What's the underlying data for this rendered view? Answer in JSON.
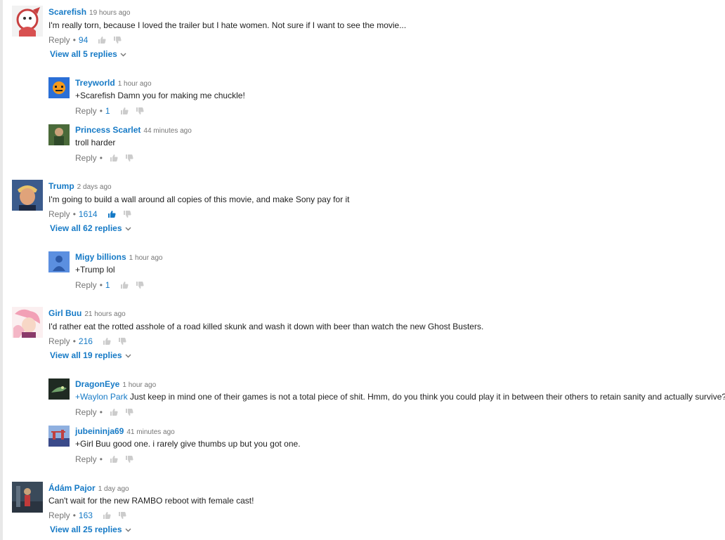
{
  "labels": {
    "reply": "Reply",
    "dot": "•"
  },
  "comments": [
    {
      "author": "Scarefish",
      "time": "19 hours ago",
      "text": "I'm really torn, because I loved the trailer but I hate women. Not sure if I want to see the movie...",
      "likes": "94",
      "view_all": "View all 5 replies",
      "replies": [
        {
          "author": "Treyworld",
          "time": "1 hour ago",
          "mention": "+Scarefish",
          "text": " Damn you for making me chuckle!",
          "likes": "1"
        },
        {
          "author": "Princess Scarlet",
          "time": "44 minutes ago",
          "text": "troll harder"
        }
      ]
    },
    {
      "author": "Trump",
      "time": "2 days ago",
      "text": "I'm going to build a wall around all copies of this movie, and make Sony pay for it",
      "likes": "1614",
      "liked": true,
      "view_all": "View all 62 replies",
      "replies": [
        {
          "author": "Migy billions",
          "time": "1 hour ago",
          "mention": "+Trump",
          "text": " lol",
          "likes": "1"
        }
      ]
    },
    {
      "author": "Girl Buu",
      "time": "21 hours ago",
      "text": "I'd rather eat the rotted asshole of a road killed skunk and wash it down with beer than watch the new Ghost Busters.",
      "likes": "216",
      "view_all": "View all 19 replies",
      "replies": [
        {
          "author": "DragonEye",
          "time": "1 hour ago",
          "mention": "+Waylon Park",
          "text": " Just keep in mind one of their games is not a total piece of shit. Hmm, do you think you could play it in between their others to retain sanity and actually survive?"
        },
        {
          "author": "jubeininja69",
          "time": "41 minutes ago",
          "mention": "+Girl Buu",
          "text": " good one. i rarely give thumbs up but you got one."
        }
      ]
    },
    {
      "author": "Ádám Pajor",
      "time": "1 day ago",
      "text": "Can't wait for the new RAMBO reboot with female cast!",
      "likes": "163",
      "view_all": "View all 25 replies",
      "replies": []
    }
  ],
  "colors": {
    "link": "#167ac6",
    "meta": "#767676",
    "text": "#222222",
    "thumb": "#cccccc",
    "thumb_active": "#167ac6"
  }
}
